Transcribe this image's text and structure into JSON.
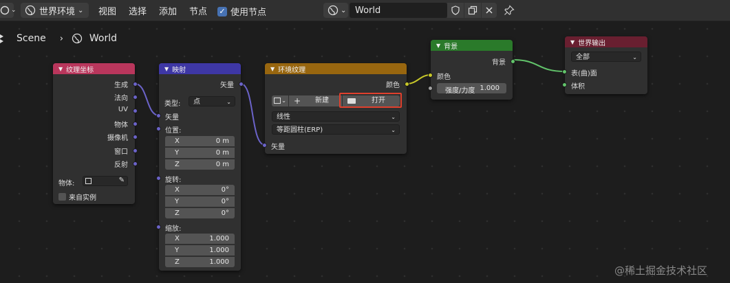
{
  "header": {
    "world_env_label": "世界环境",
    "menus": [
      "视图",
      "选择",
      "添加",
      "节点"
    ],
    "use_nodes_label": "使用节点",
    "world_name": "World"
  },
  "breadcrumb": {
    "scene": "Scene",
    "world": "World"
  },
  "nodes": {
    "texcoord": {
      "title": "纹理坐标",
      "outputs": [
        "生成",
        "法向",
        "UV",
        "物体",
        "摄像机",
        "窗口",
        "反射"
      ],
      "object_label": "物体:",
      "from_instancer": "来自实例"
    },
    "mapping": {
      "title": "映射",
      "output": "矢量",
      "type_label": "类型:",
      "type_value": "点",
      "vector_input": "矢量",
      "location_label": "位置:",
      "location": [
        [
          "X",
          "0 m"
        ],
        [
          "Y",
          "0 m"
        ],
        [
          "Z",
          "0 m"
        ]
      ],
      "rotation_label": "旋转:",
      "rotation": [
        [
          "X",
          "0°"
        ],
        [
          "Y",
          "0°"
        ],
        [
          "Z",
          "0°"
        ]
      ],
      "scale_label": "缩放:",
      "scale": [
        [
          "X",
          "1.000"
        ],
        [
          "Y",
          "1.000"
        ],
        [
          "Z",
          "1.000"
        ]
      ]
    },
    "envtex": {
      "title": "环境纹理",
      "output": "颜色",
      "new_label": "新建",
      "open_label": "打开",
      "interp": "线性",
      "projection": "等距圆柱(ERP)",
      "vector_input": "矢量"
    },
    "background": {
      "title": "背景",
      "output": "背景",
      "color_input": "颜色",
      "strength_label": "强度/力度",
      "strength_value": "1.000"
    },
    "world_output": {
      "title": "世界输出",
      "target": "全部",
      "surface": "表(曲)面",
      "volume": "体积"
    }
  },
  "colors": {
    "texcoord_head": "#b9365c",
    "mapping_head": "#3e37a5",
    "envtex_head": "#98660f",
    "background_head": "#2a7a2a",
    "world_output_head": "#691f30",
    "highlight": "#e0402d"
  },
  "watermark": "@稀土掘金技术社区"
}
